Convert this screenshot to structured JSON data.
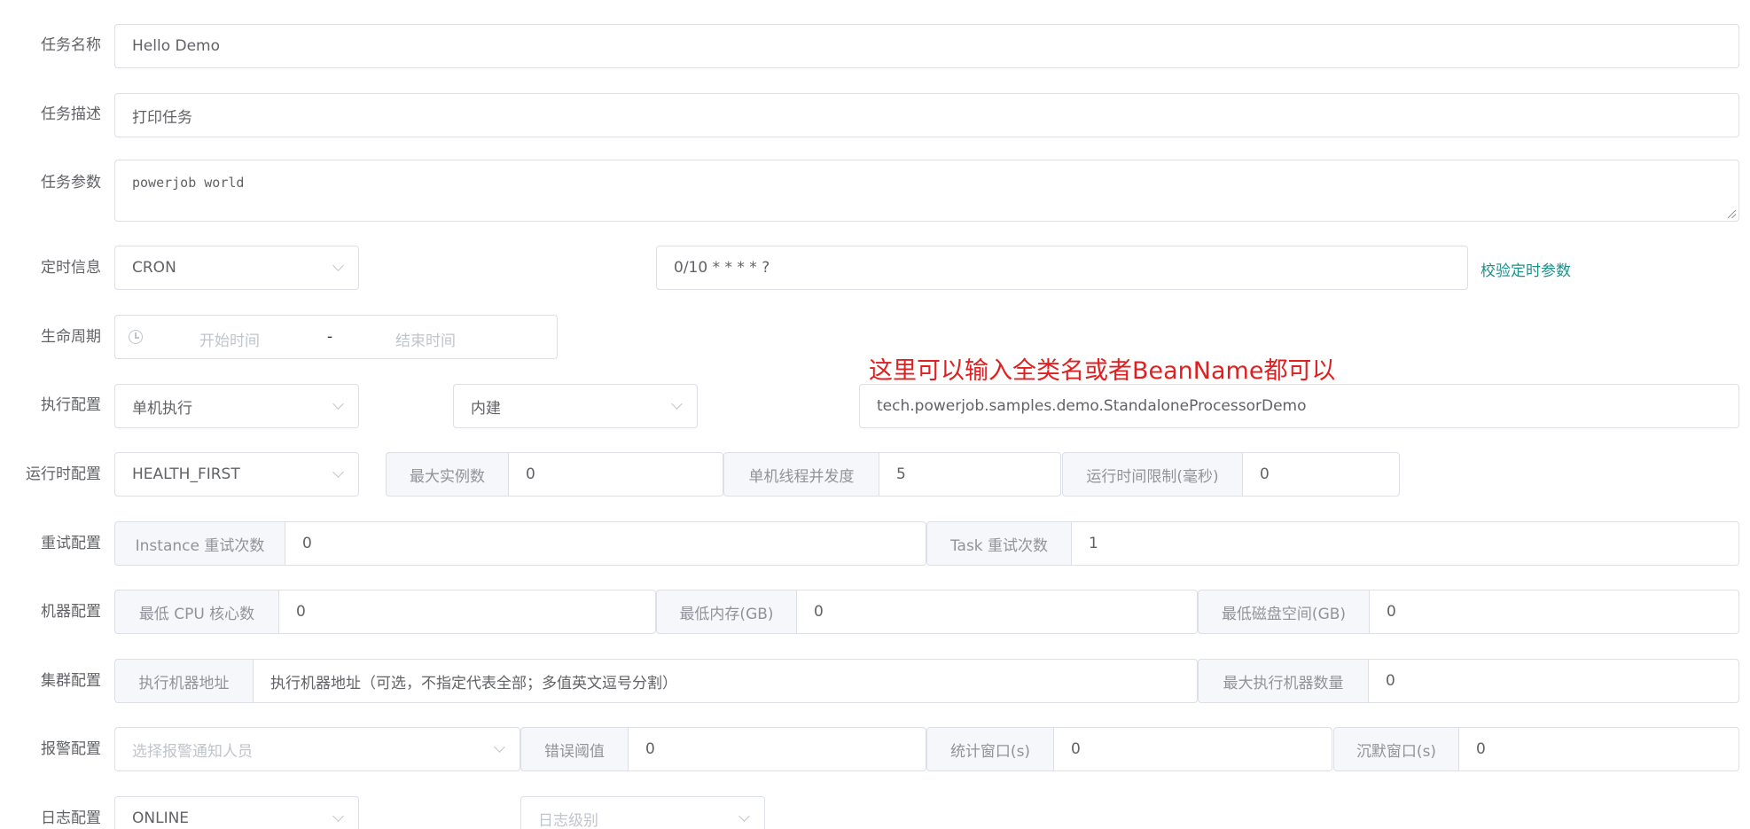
{
  "labels": {
    "task_name": "任务名称",
    "task_desc": "任务描述",
    "task_params": "任务参数",
    "timing": "定时信息",
    "lifecycle": "生命周期",
    "execution": "执行配置",
    "runtime": "运行时配置",
    "retry": "重试配置",
    "machine": "机器配置",
    "cluster": "集群配置",
    "alarm": "报警配置",
    "log": "日志配置"
  },
  "task_name": {
    "value": "Hello Demo"
  },
  "task_desc": {
    "value": "打印任务"
  },
  "task_params": {
    "value": "powerjob world"
  },
  "timing": {
    "type": "CRON",
    "expression": "0/10 * * * * ?",
    "validate_link": "校验定时参数"
  },
  "lifecycle": {
    "start_placeholder": "开始时间",
    "separator": "-",
    "end_placeholder": "结束时间"
  },
  "execution": {
    "mode": "单机执行",
    "processor_type": "内建",
    "processor_info": "tech.powerjob.samples.demo.StandaloneProcessorDemo",
    "annotation": "这里可以输入全类名或者BeanName都可以"
  },
  "runtime": {
    "dispatch_strategy": "HEALTH_FIRST",
    "max_instances_label": "最大实例数",
    "max_instances": "0",
    "concurrency_label": "单机线程并发度",
    "concurrency": "5",
    "time_limit_label": "运行时间限制(毫秒)",
    "time_limit": "0"
  },
  "retry": {
    "instance_label": "Instance 重试次数",
    "instance_value": "0",
    "task_label": "Task 重试次数",
    "task_value": "1"
  },
  "machine": {
    "cpu_label": "最低 CPU 核心数",
    "cpu_value": "0",
    "memory_label": "最低内存(GB)",
    "memory_value": "0",
    "disk_label": "最低磁盘空间(GB)",
    "disk_value": "0"
  },
  "cluster": {
    "address_label": "执行机器地址",
    "address_placeholder": "执行机器地址（可选，不指定代表全部；多值英文逗号分割）",
    "max_machines_label": "最大执行机器数量",
    "max_machines_value": "0"
  },
  "alarm": {
    "receivers_placeholder": "选择报警通知人员",
    "threshold_label": "错误阈值",
    "threshold_value": "0",
    "window_label": "统计窗口(s)",
    "window_value": "0",
    "silence_label": "沉默窗口(s)",
    "silence_value": "0"
  },
  "log": {
    "type": "ONLINE",
    "level_placeholder": "日志级别"
  },
  "colors": {
    "link": "#1f8f8a",
    "annotation": "#e02020",
    "border": "#dcdfe6",
    "prefix_bg": "#f5f7fa"
  }
}
